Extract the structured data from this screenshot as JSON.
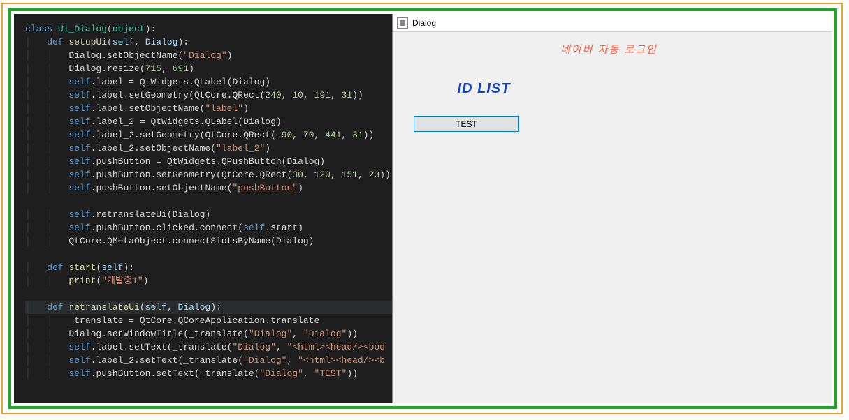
{
  "code": {
    "lines": [
      {
        "indent": 0,
        "tokens": [
          {
            "t": "class ",
            "c": "k-blue"
          },
          {
            "t": "Ui_Dialog",
            "c": "k-teal"
          },
          {
            "t": "(",
            "c": "k-white"
          },
          {
            "t": "object",
            "c": "k-teal"
          },
          {
            "t": "):",
            "c": "k-white"
          }
        ]
      },
      {
        "indent": 1,
        "tokens": [
          {
            "t": "def ",
            "c": "k-blue"
          },
          {
            "t": "setupUi",
            "c": "k-yellow"
          },
          {
            "t": "(",
            "c": "k-white"
          },
          {
            "t": "self",
            "c": "k-lblue"
          },
          {
            "t": ", ",
            "c": "k-white"
          },
          {
            "t": "Dialog",
            "c": "k-lblue"
          },
          {
            "t": "):",
            "c": "k-white"
          }
        ]
      },
      {
        "indent": 2,
        "tokens": [
          {
            "t": "Dialog.setObjectName(",
            "c": "k-white"
          },
          {
            "t": "\"Dialog\"",
            "c": "k-str"
          },
          {
            "t": ")",
            "c": "k-white"
          }
        ]
      },
      {
        "indent": 2,
        "tokens": [
          {
            "t": "Dialog.resize(",
            "c": "k-white"
          },
          {
            "t": "715",
            "c": "k-num"
          },
          {
            "t": ", ",
            "c": "k-white"
          },
          {
            "t": "691",
            "c": "k-num"
          },
          {
            "t": ")",
            "c": "k-white"
          }
        ]
      },
      {
        "indent": 2,
        "tokens": [
          {
            "t": "self",
            "c": "k-blue"
          },
          {
            "t": ".label = QtWidgets.QLabel(Dialog)",
            "c": "k-white"
          }
        ]
      },
      {
        "indent": 2,
        "tokens": [
          {
            "t": "self",
            "c": "k-blue"
          },
          {
            "t": ".label.setGeometry(QtCore.QRect(",
            "c": "k-white"
          },
          {
            "t": "240",
            "c": "k-num"
          },
          {
            "t": ", ",
            "c": "k-white"
          },
          {
            "t": "10",
            "c": "k-num"
          },
          {
            "t": ", ",
            "c": "k-white"
          },
          {
            "t": "191",
            "c": "k-num"
          },
          {
            "t": ", ",
            "c": "k-white"
          },
          {
            "t": "31",
            "c": "k-num"
          },
          {
            "t": "))",
            "c": "k-white"
          }
        ]
      },
      {
        "indent": 2,
        "tokens": [
          {
            "t": "self",
            "c": "k-blue"
          },
          {
            "t": ".label.setObjectName(",
            "c": "k-white"
          },
          {
            "t": "\"label\"",
            "c": "k-str"
          },
          {
            "t": ")",
            "c": "k-white"
          }
        ]
      },
      {
        "indent": 2,
        "tokens": [
          {
            "t": "self",
            "c": "k-blue"
          },
          {
            "t": ".label_2 = QtWidgets.QLabel(Dialog)",
            "c": "k-white"
          }
        ]
      },
      {
        "indent": 2,
        "tokens": [
          {
            "t": "self",
            "c": "k-blue"
          },
          {
            "t": ".label_2.setGeometry(QtCore.QRect(-",
            "c": "k-white"
          },
          {
            "t": "90",
            "c": "k-num"
          },
          {
            "t": ", ",
            "c": "k-white"
          },
          {
            "t": "70",
            "c": "k-num"
          },
          {
            "t": ", ",
            "c": "k-white"
          },
          {
            "t": "441",
            "c": "k-num"
          },
          {
            "t": ", ",
            "c": "k-white"
          },
          {
            "t": "31",
            "c": "k-num"
          },
          {
            "t": "))",
            "c": "k-white"
          }
        ]
      },
      {
        "indent": 2,
        "tokens": [
          {
            "t": "self",
            "c": "k-blue"
          },
          {
            "t": ".label_2.setObjectName(",
            "c": "k-white"
          },
          {
            "t": "\"label_2\"",
            "c": "k-str"
          },
          {
            "t": ")",
            "c": "k-white"
          }
        ]
      },
      {
        "indent": 2,
        "tokens": [
          {
            "t": "self",
            "c": "k-blue"
          },
          {
            "t": ".pushButton = QtWidgets.QPushButton(Dialog)",
            "c": "k-white"
          }
        ]
      },
      {
        "indent": 2,
        "tokens": [
          {
            "t": "self",
            "c": "k-blue"
          },
          {
            "t": ".pushButton.setGeometry(QtCore.QRect(",
            "c": "k-white"
          },
          {
            "t": "30",
            "c": "k-num"
          },
          {
            "t": ", ",
            "c": "k-white"
          },
          {
            "t": "120",
            "c": "k-num"
          },
          {
            "t": ", ",
            "c": "k-white"
          },
          {
            "t": "151",
            "c": "k-num"
          },
          {
            "t": ", ",
            "c": "k-white"
          },
          {
            "t": "23",
            "c": "k-num"
          },
          {
            "t": "))",
            "c": "k-white"
          }
        ]
      },
      {
        "indent": 2,
        "tokens": [
          {
            "t": "self",
            "c": "k-blue"
          },
          {
            "t": ".pushButton.setObjectName(",
            "c": "k-white"
          },
          {
            "t": "\"pushButton\"",
            "c": "k-str"
          },
          {
            "t": ")",
            "c": "k-white"
          }
        ]
      },
      {
        "indent": 0,
        "tokens": [
          {
            "t": "",
            "c": "k-white"
          }
        ]
      },
      {
        "indent": 2,
        "tokens": [
          {
            "t": "self",
            "c": "k-blue"
          },
          {
            "t": ".retranslateUi(Dialog)",
            "c": "k-white"
          }
        ]
      },
      {
        "indent": 2,
        "tokens": [
          {
            "t": "self",
            "c": "k-blue"
          },
          {
            "t": ".pushButton.clicked.connect(",
            "c": "k-white"
          },
          {
            "t": "self",
            "c": "k-blue"
          },
          {
            "t": ".start)",
            "c": "k-white"
          }
        ]
      },
      {
        "indent": 2,
        "tokens": [
          {
            "t": "QtCore.QMetaObject.connectSlotsByName(Dialog)",
            "c": "k-white"
          }
        ]
      },
      {
        "indent": 0,
        "tokens": [
          {
            "t": "",
            "c": "k-white"
          }
        ]
      },
      {
        "indent": 1,
        "tokens": [
          {
            "t": "def ",
            "c": "k-blue"
          },
          {
            "t": "start",
            "c": "k-yellow"
          },
          {
            "t": "(",
            "c": "k-white"
          },
          {
            "t": "self",
            "c": "k-lblue"
          },
          {
            "t": "):",
            "c": "k-white"
          }
        ]
      },
      {
        "indent": 2,
        "tokens": [
          {
            "t": "print",
            "c": "k-yellow"
          },
          {
            "t": "(",
            "c": "k-white"
          },
          {
            "t": "\"개발중1\"",
            "c": "k-str"
          },
          {
            "t": ")",
            "c": "k-white"
          }
        ]
      },
      {
        "indent": 0,
        "tokens": [
          {
            "t": "",
            "c": "k-white"
          }
        ]
      },
      {
        "indent": 1,
        "hl": true,
        "tokens": [
          {
            "t": "def ",
            "c": "k-blue"
          },
          {
            "t": "retranslateUi",
            "c": "k-yellow"
          },
          {
            "t": "(",
            "c": "k-white"
          },
          {
            "t": "self",
            "c": "k-lblue"
          },
          {
            "t": ", ",
            "c": "k-white"
          },
          {
            "t": "Dialog",
            "c": "k-lblue"
          },
          {
            "t": "):",
            "c": "k-white"
          }
        ]
      },
      {
        "indent": 2,
        "tokens": [
          {
            "t": "_translate = QtCore.QCoreApplication.translate",
            "c": "k-white"
          }
        ]
      },
      {
        "indent": 2,
        "tokens": [
          {
            "t": "Dialog.setWindowTitle(_translate(",
            "c": "k-white"
          },
          {
            "t": "\"Dialog\"",
            "c": "k-str"
          },
          {
            "t": ", ",
            "c": "k-white"
          },
          {
            "t": "\"Dialog\"",
            "c": "k-str"
          },
          {
            "t": "))",
            "c": "k-white"
          }
        ]
      },
      {
        "indent": 2,
        "tokens": [
          {
            "t": "self",
            "c": "k-blue"
          },
          {
            "t": ".label.setText(_translate(",
            "c": "k-white"
          },
          {
            "t": "\"Dialog\"",
            "c": "k-str"
          },
          {
            "t": ", ",
            "c": "k-white"
          },
          {
            "t": "\"<html><head/><bod",
            "c": "k-str"
          }
        ]
      },
      {
        "indent": 2,
        "tokens": [
          {
            "t": "self",
            "c": "k-blue"
          },
          {
            "t": ".label_2.setText(_translate(",
            "c": "k-white"
          },
          {
            "t": "\"Dialog\"",
            "c": "k-str"
          },
          {
            "t": ", ",
            "c": "k-white"
          },
          {
            "t": "\"<html><head/><b",
            "c": "k-str"
          }
        ]
      },
      {
        "indent": 2,
        "tokens": [
          {
            "t": "self",
            "c": "k-blue"
          },
          {
            "t": ".pushButton.setText(_translate(",
            "c": "k-white"
          },
          {
            "t": "\"Dialog\"",
            "c": "k-str"
          },
          {
            "t": ", ",
            "c": "k-white"
          },
          {
            "t": "\"TEST\"",
            "c": "k-str"
          },
          {
            "t": "))",
            "c": "k-white"
          }
        ]
      }
    ]
  },
  "dialog": {
    "title": "Dialog",
    "label1": "네이버 자동 로그인",
    "label2": "ID LIST",
    "button": "TEST"
  }
}
